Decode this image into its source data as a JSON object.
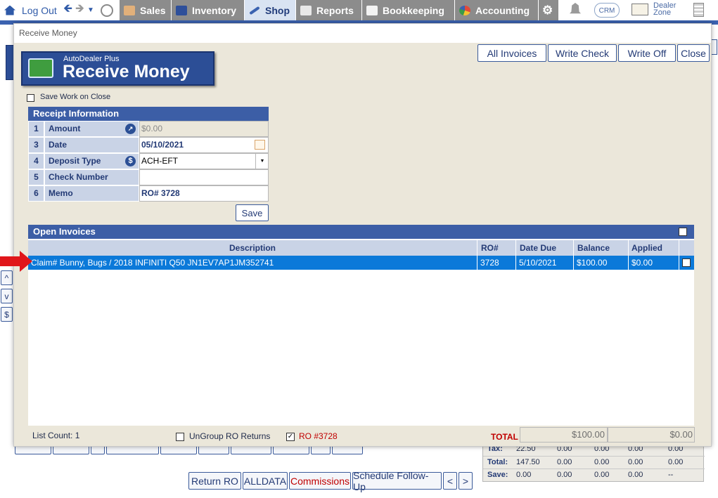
{
  "nav": {
    "logout": "Log Out",
    "tabs": {
      "sales": "Sales",
      "inventory": "Inventory",
      "shop": "Shop",
      "reports": "Reports",
      "bookkeeping": "Bookkeeping",
      "accounting": "Accounting"
    },
    "crm": "CRM",
    "dealer_zone_line1": "Dealer",
    "dealer_zone_line2": "Zone"
  },
  "background": {
    "side_buttons": [
      "^",
      "v",
      "$"
    ],
    "bottom_buttons": [
      "Return RO",
      "ALLDATA",
      "Commissions",
      "Schedule Follow-Up",
      "<",
      ">"
    ],
    "summary": {
      "rows": [
        {
          "label": "Tax:",
          "values": [
            "22.50",
            "0.00",
            "0.00",
            "0.00",
            "0.00"
          ]
        },
        {
          "label": "Total:",
          "values": [
            "147.50",
            "0.00",
            "0.00",
            "0.00",
            "0.00"
          ]
        },
        {
          "label": "Save:",
          "values": [
            "0.00",
            "0.00",
            "0.00",
            "0.00",
            "--"
          ]
        }
      ]
    }
  },
  "dialog": {
    "title": "Receive Money",
    "buttons": {
      "all_invoices": "All Invoices",
      "write_check": "Write Check",
      "write_off": "Write Off",
      "close": "Close"
    },
    "logo_top": "AutoDealer Plus",
    "logo_main": "Receive Money",
    "save_work_label": "Save Work on Close",
    "receipt": {
      "title": "Receipt Information",
      "rows": [
        {
          "num": "1",
          "label": "Amount",
          "value": "$0.00"
        },
        {
          "num": "3",
          "label": "Date",
          "value": "05/10/2021"
        },
        {
          "num": "4",
          "label": "Deposit Type",
          "value": "ACH-EFT"
        },
        {
          "num": "5",
          "label": "Check Number",
          "value": ""
        },
        {
          "num": "6",
          "label": "Memo",
          "value": "RO# 3728"
        }
      ],
      "save_label": "Save"
    },
    "invoices": {
      "title": "Open Invoices",
      "columns": [
        "Description",
        "RO#",
        "Date Due",
        "Balance",
        "Applied"
      ],
      "rows": [
        {
          "description": "Claim#  Bunny, Bugs / 2018 INFINITI Q50 JN1EV7AP1JM352741",
          "ro": "3728",
          "date_due": "5/10/2021",
          "balance": "$100.00",
          "applied": "$0.00"
        }
      ]
    },
    "footer": {
      "list_count": "List Count: 1",
      "ungroup_label": "UnGroup RO Returns",
      "ro_filter_label": "RO #3728",
      "total_label": "TOTAL",
      "total_balance": "$100.00",
      "total_applied": "$0.00"
    }
  }
}
